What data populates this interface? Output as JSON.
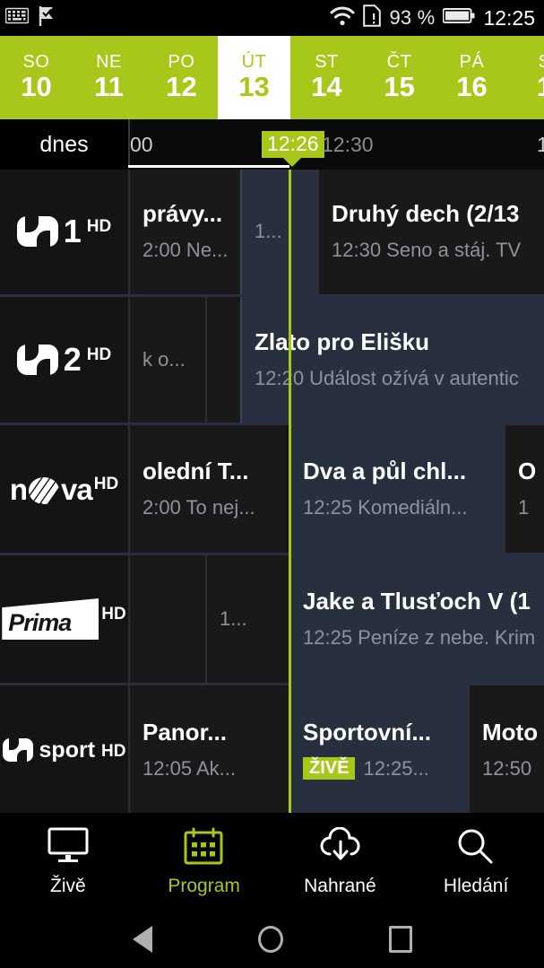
{
  "statusbar": {
    "icons": [
      "keyboard-icon",
      "flag-check-icon",
      "wifi-icon",
      "sim-card-icon",
      "battery-icon"
    ],
    "battery_percent": "93 %",
    "clock": "12:25"
  },
  "daystrip": {
    "accent_color": "#a7c81a",
    "days": [
      {
        "dow": "SO",
        "num": "10",
        "selected": false
      },
      {
        "dow": "NE",
        "num": "11",
        "selected": false
      },
      {
        "dow": "PO",
        "num": "12",
        "selected": false
      },
      {
        "dow": "ÚT",
        "num": "13",
        "selected": true
      },
      {
        "dow": "ST",
        "num": "14",
        "selected": false
      },
      {
        "dow": "ČT",
        "num": "15",
        "selected": false
      },
      {
        "dow": "PÁ",
        "num": "16",
        "selected": false
      },
      {
        "dow": "S",
        "num": "1",
        "selected": false
      }
    ]
  },
  "timeline": {
    "today_label": "dnes",
    "tick_partial_left": "00",
    "now_label": "12:26",
    "tick_next": "12:30",
    "tick_right_partial": "1"
  },
  "grid": {
    "now_line_color": "#a7c81a",
    "rows": [
      {
        "channel": "ČT1 HD",
        "channel_logo": "ct1-hd-logo",
        "programs": [
          {
            "title": "právy...",
            "sub": "2:00 Ne...",
            "highlight": false,
            "small": false,
            "live": false
          },
          {
            "title": "",
            "sub": "1...",
            "highlight": true,
            "small": true,
            "live": false
          },
          {
            "title": "Druhý dech (2/13",
            "sub": "12:30 Seno a stáj. TV",
            "highlight": false,
            "small": false,
            "live": false
          }
        ]
      },
      {
        "channel": "ČT2 HD",
        "channel_logo": "ct2-hd-logo",
        "programs": [
          {
            "title": "",
            "sub": "k o...",
            "highlight": false,
            "small": true,
            "live": false
          },
          {
            "title": "",
            "sub": "",
            "highlight": false,
            "small": true,
            "live": false
          },
          {
            "title": "Zlato pro Elišku",
            "sub": "12:20 Událost ožívá v autentic",
            "highlight": true,
            "small": false,
            "live": false
          }
        ]
      },
      {
        "channel": "Nova HD",
        "channel_logo": "nova-hd-logo",
        "programs": [
          {
            "title": "olední T...",
            "sub": "2:00 To nej...",
            "highlight": false,
            "small": false,
            "live": false
          },
          {
            "title": "Dva a půl chl...",
            "sub": "12:25 Komediáln...",
            "highlight": true,
            "small": false,
            "live": false
          },
          {
            "title": "O",
            "sub": "1",
            "highlight": false,
            "small": false,
            "live": false
          }
        ]
      },
      {
        "channel": "Prima HD",
        "channel_logo": "prima-hd-logo",
        "programs": [
          {
            "title": "",
            "sub": "",
            "highlight": false,
            "small": true,
            "live": false
          },
          {
            "title": "",
            "sub": "1...",
            "highlight": false,
            "small": true,
            "live": false
          },
          {
            "title": "Jake a Tlusťoch V (1",
            "sub": "12:25 Peníze z nebe. Krim",
            "highlight": true,
            "small": false,
            "live": false
          }
        ]
      },
      {
        "channel": "ČT sport HD",
        "channel_logo": "ct-sport-hd-logo",
        "programs": [
          {
            "title": "Panor...",
            "sub": "12:05 Ak...",
            "highlight": false,
            "small": false,
            "live": false
          },
          {
            "title": "Sportovní...",
            "sub": "12:25...",
            "highlight": true,
            "small": false,
            "live": true,
            "live_label": "ŽIVĚ"
          },
          {
            "title": "Moto",
            "sub": "12:50",
            "highlight": false,
            "small": false,
            "live": false
          }
        ]
      }
    ]
  },
  "bottomnav": {
    "items": [
      {
        "label": "Živě",
        "icon": "tv-monitor-icon",
        "active": false
      },
      {
        "label": "Program",
        "icon": "calendar-icon",
        "active": true
      },
      {
        "label": "Nahrané",
        "icon": "cloud-download-icon",
        "active": false
      },
      {
        "label": "Hledání",
        "icon": "search-icon",
        "active": false
      }
    ]
  },
  "androidnav": {
    "items": [
      "back-icon",
      "home-icon",
      "recents-icon"
    ]
  }
}
